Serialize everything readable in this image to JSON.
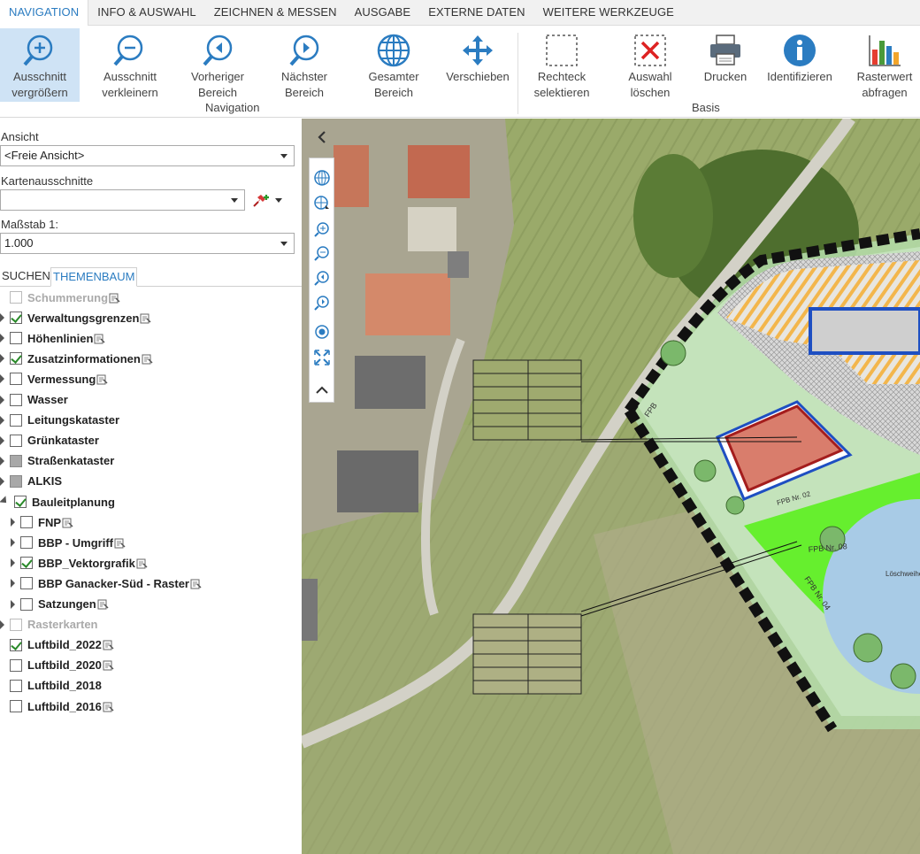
{
  "tabs": [
    {
      "label": "NAVIGATION",
      "active": true
    },
    {
      "label": "INFO & AUSWAHL",
      "active": false
    },
    {
      "label": "ZEICHNEN & MESSEN",
      "active": false
    },
    {
      "label": "AUSGABE",
      "active": false
    },
    {
      "label": "EXTERNE DATEN",
      "active": false
    },
    {
      "label": "WEITERE WERKZEUGE",
      "active": false
    }
  ],
  "ribbon": {
    "tools": [
      {
        "id": "zoom-in",
        "line1": "Ausschnitt",
        "line2": "vergrößern",
        "icon": "zoom-in-icon",
        "active": true
      },
      {
        "id": "zoom-out",
        "line1": "Ausschnitt",
        "line2": "verkleinern",
        "icon": "zoom-out-icon"
      },
      {
        "id": "prev",
        "line1": "Vorheriger",
        "line2": "Bereich",
        "icon": "back-icon"
      },
      {
        "id": "next",
        "line1": "Nächster",
        "line2": "Bereich",
        "icon": "forward-icon"
      },
      {
        "id": "full",
        "line1": "Gesamter",
        "line2": "Bereich",
        "icon": "globe-icon"
      },
      {
        "id": "pan",
        "line1": "Verschieben",
        "line2": "",
        "icon": "move-icon"
      },
      {
        "id": "rect-select",
        "line1": "Rechteck",
        "line2": "selektieren",
        "icon": "rectangle-select-icon"
      },
      {
        "id": "clear-select",
        "line1": "Auswahl",
        "line2": "löschen",
        "icon": "clear-selection-icon"
      },
      {
        "id": "print",
        "line1": "Drucken",
        "line2": "",
        "icon": "printer-icon"
      },
      {
        "id": "identify",
        "line1": "Identifizieren",
        "line2": "",
        "icon": "info-icon"
      },
      {
        "id": "raster-query",
        "line1": "Rasterwert",
        "line2": "abfragen",
        "icon": "bar-chart-icon"
      }
    ],
    "groups": {
      "navigation": "Navigation",
      "basis": "Basis"
    },
    "accent": "#2b7cc1",
    "active_bg": "#cfe3f5"
  },
  "panel": {
    "view_label": "Ansicht",
    "view_value": "<Freie Ansicht>",
    "extracts_label": "Kartenausschnitte",
    "extracts_value": "",
    "scale_label": "Maßstab 1:",
    "scale_value": "1.000",
    "subtabs": [
      {
        "label": "SUCHEN",
        "active": false
      },
      {
        "label": "THEMENBAUM",
        "active": true
      }
    ]
  },
  "tree": [
    {
      "label": "Schummerung",
      "state": "off",
      "expand": "none",
      "disabled": true,
      "legend": true,
      "level": 0
    },
    {
      "label": "Verwaltungsgrenzen",
      "state": "on",
      "expand": "closed",
      "legend": true,
      "level": 0
    },
    {
      "label": "Höhenlinien",
      "state": "off",
      "expand": "closed",
      "legend": true,
      "level": 0
    },
    {
      "label": "Zusatzinformationen",
      "state": "on",
      "expand": "closed",
      "legend": true,
      "level": 0
    },
    {
      "label": "Vermessung",
      "state": "off",
      "expand": "closed",
      "legend": true,
      "level": 0
    },
    {
      "label": "Wasser",
      "state": "off",
      "expand": "closed",
      "legend": false,
      "level": 0
    },
    {
      "label": "Leitungskataster",
      "state": "off",
      "expand": "closed",
      "legend": false,
      "level": 0
    },
    {
      "label": "Grünkataster",
      "state": "off",
      "expand": "closed",
      "legend": false,
      "level": 0
    },
    {
      "label": "Straßenkataster",
      "state": "partial",
      "expand": "closed",
      "legend": false,
      "level": 0
    },
    {
      "label": "ALKIS",
      "state": "partial",
      "expand": "closed",
      "legend": false,
      "level": 0
    },
    {
      "label": "Bauleitplanung",
      "state": "on",
      "expand": "open",
      "legend": false,
      "level": 0
    },
    {
      "label": "FNP",
      "state": "off",
      "expand": "closed",
      "legend": true,
      "level": 1
    },
    {
      "label": "BBP - Umgriff",
      "state": "off",
      "expand": "closed",
      "legend": true,
      "level": 1
    },
    {
      "label": "BBP_Vektorgrafik",
      "state": "on",
      "expand": "closed",
      "legend": true,
      "level": 1
    },
    {
      "label": "BBP Ganacker-Süd - Raster",
      "state": "off",
      "expand": "closed",
      "legend": true,
      "level": 1
    },
    {
      "label": "Satzungen",
      "state": "off",
      "expand": "closed",
      "legend": true,
      "level": 1
    },
    {
      "label": "Rasterkarten",
      "state": "off",
      "expand": "closed",
      "disabled": true,
      "legend": false,
      "level": 0
    },
    {
      "label": "Luftbild_2022",
      "state": "on",
      "expand": "none",
      "legend": true,
      "level": 0
    },
    {
      "label": "Luftbild_2020",
      "state": "off",
      "expand": "none",
      "legend": true,
      "level": 0
    },
    {
      "label": "Luftbild_2018",
      "state": "off",
      "expand": "none",
      "legend": false,
      "level": 0
    },
    {
      "label": "Luftbild_2016",
      "state": "off",
      "expand": "none",
      "legend": true,
      "level": 0
    }
  ],
  "map": {
    "labels": [
      "FPB Nr. 08",
      "FPB Nr. 02",
      "FPB Nr. 04",
      "Löschweiher",
      "FPB"
    ],
    "map_toolbar": [
      "globe-icon",
      "globe-refresh-icon",
      "zoom-in-icon",
      "zoom-out-icon",
      "zoom-back-icon",
      "zoom-forward-icon",
      "location-icon",
      "full-extent-icon",
      "collapse-up-icon"
    ]
  }
}
